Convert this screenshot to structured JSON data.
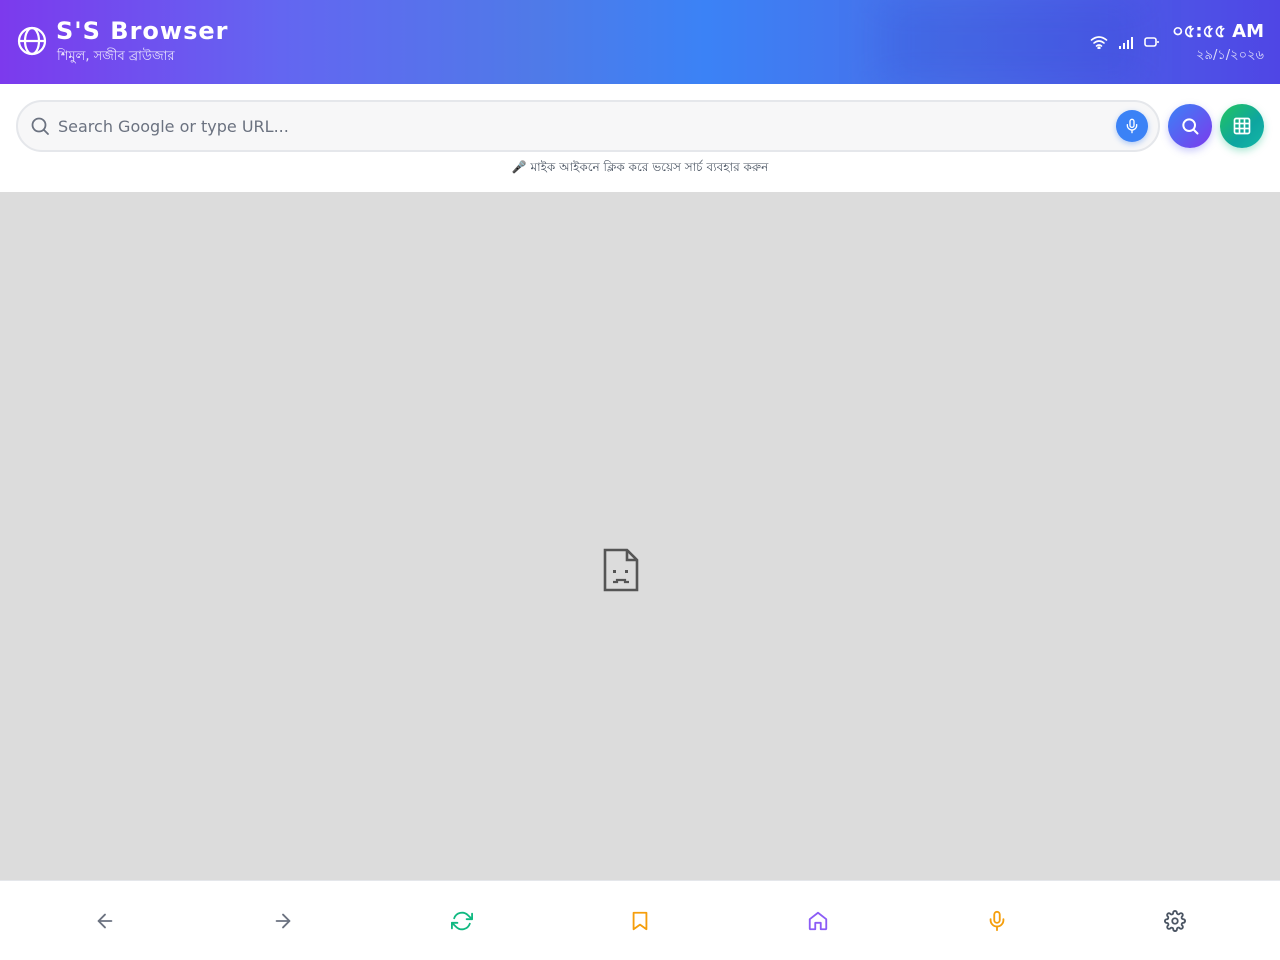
{
  "header": {
    "title": "S'S Browser",
    "subtitle": "শিমুল, সজীব ব্রাউজার",
    "time": "০৫:৫৫ AM",
    "date": "২৯/১/২০২৬",
    "gradient_colors": [
      "#7c3aed",
      "#3b82f6",
      "#4f46e5"
    ]
  },
  "search": {
    "placeholder": "Search Google or type URL...",
    "value": "",
    "hint": "🎤 মাইক আইকনে ক্লিক করে ভয়েস সার্চ ব্যবহার করুন"
  },
  "buttons": {
    "mic_color": "#3b82f6",
    "go_colors": [
      "#3b82f6",
      "#7c3aed"
    ],
    "apps_colors": [
      "#22c55e",
      "#14b8a6"
    ]
  },
  "content": {
    "state": "broken-page",
    "background": "#dcdcdc"
  },
  "bottom_nav": {
    "items": [
      {
        "icon": "arrow-left-icon",
        "color": "#6b7280"
      },
      {
        "icon": "arrow-right-icon",
        "color": "#6b7280"
      },
      {
        "icon": "refresh-icon",
        "color": "#10b981"
      },
      {
        "icon": "bookmark-icon",
        "color": "#f59e0b"
      },
      {
        "icon": "home-icon",
        "color": "#8b5cf6"
      },
      {
        "icon": "microphone-icon",
        "color": "#f59e0b"
      },
      {
        "icon": "settings-icon",
        "color": "#4b5563"
      }
    ]
  }
}
